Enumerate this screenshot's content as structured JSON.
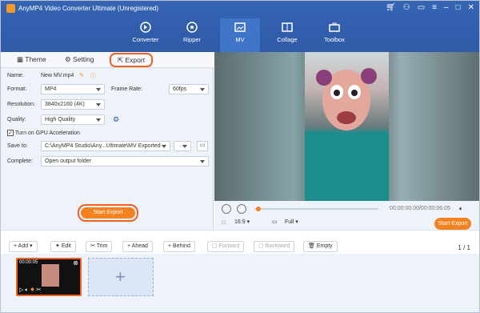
{
  "window": {
    "title": "AnyMP4 Video Converter Ultimate (Unregistered)"
  },
  "nav": {
    "tabs": [
      "Converter",
      "Ripper",
      "MV",
      "Collage",
      "Toolbox"
    ]
  },
  "panel": {
    "tabs": [
      "Theme",
      "Setting",
      "Export"
    ],
    "name_label": "Name:",
    "name_value": "New MV.mp4",
    "format_label": "Format:",
    "format_value": "MP4",
    "framerate_label": "Frame Rate:",
    "framerate_value": "60fps",
    "resolution_label": "Resolution:",
    "resolution_value": "3840x2160 (4K)",
    "quality_label": "Quality:",
    "quality_value": "High Quality",
    "gpu_label": "Turn on GPU Acceleration",
    "saveto_label": "Save to:",
    "saveto_value": "C:\\AnyMP4 Studio\\Any...Ultimate\\MV Exported",
    "complete_label": "Complete:",
    "complete_value": "Open output folder",
    "start_export": "Start Export"
  },
  "player": {
    "time": "00:00:00.00/00:00:06.05",
    "ratio": "16:9",
    "view": "Full",
    "start_export": "Start Export"
  },
  "toolbar": {
    "add": "Add",
    "edit": "Edit",
    "trim": "Trim",
    "ahead": "Ahead",
    "behind": "Behind",
    "forward": "Forward",
    "backward": "Backward",
    "empty": "Empty",
    "page": "1 / 1"
  },
  "timeline": {
    "clip_time": "00:00:05"
  },
  "colors": {
    "header": "#2f5aa8",
    "accent": "#f58220",
    "highlight": "#f06122"
  }
}
